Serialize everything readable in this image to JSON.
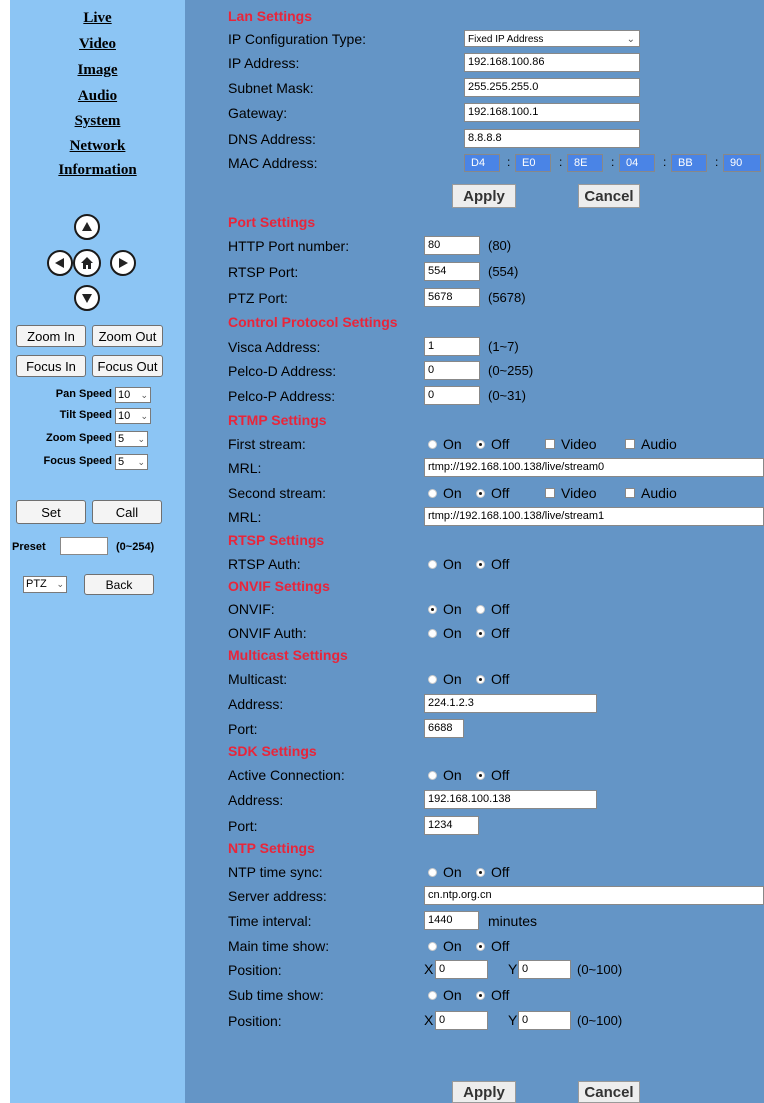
{
  "nav": {
    "items": [
      "Live",
      "Video",
      "Image",
      "Audio",
      "System",
      "Network",
      "Information"
    ]
  },
  "ptz": {
    "zoom_in": "Zoom In",
    "zoom_out": "Zoom Out",
    "focus_in": "Focus In",
    "focus_out": "Focus Out",
    "pan_speed_label": "Pan Speed",
    "pan_speed": "10",
    "tilt_speed_label": "Tilt Speed",
    "tilt_speed": "10",
    "zoom_speed_label": "Zoom Speed",
    "zoom_speed": "5",
    "focus_speed_label": "Focus Speed",
    "focus_speed": "5",
    "set": "Set",
    "call": "Call",
    "preset_label": "Preset",
    "preset_value": "",
    "preset_range": "(0~254)",
    "mode": "PTZ",
    "back": "Back"
  },
  "lan": {
    "title": "Lan Settings",
    "ip_type_label": "IP Configuration Type:",
    "ip_type": "Fixed IP Address",
    "ip_label": "IP Address:",
    "ip": "192.168.100.86",
    "mask_label": "Subnet Mask:",
    "mask": "255.255.255.0",
    "gateway_label": "Gateway:",
    "gateway": "192.168.100.1",
    "dns_label": "DNS Address:",
    "dns": "8.8.8.8",
    "mac_label": "MAC Address:",
    "mac": [
      "D4",
      "E0",
      "8E",
      "04",
      "BB",
      "90"
    ],
    "colon": ":"
  },
  "buttons": {
    "apply": "Apply",
    "cancel": "Cancel"
  },
  "port": {
    "title": "Port Settings",
    "http_label": "HTTP Port number:",
    "http": "80",
    "http_default": "(80)",
    "rtsp_label": "RTSP Port:",
    "rtsp": "554",
    "rtsp_default": "(554)",
    "ptz_label": "PTZ Port:",
    "ptz": "5678",
    "ptz_default": "(5678)"
  },
  "control": {
    "title": "Control Protocol Settings",
    "visca_label": "Visca Address:",
    "visca": "1",
    "visca_range": "(1~7)",
    "pelcod_label": "Pelco-D Address:",
    "pelcod": "0",
    "pelcod_range": "(0~255)",
    "pelcop_label": "Pelco-P Address:",
    "pelcop": "0",
    "pelcop_range": "(0~31)"
  },
  "radio": {
    "on": "On",
    "off": "Off",
    "video": "Video",
    "audio": "Audio"
  },
  "rtmp": {
    "title": "RTMP Settings",
    "first_label": "First stream:",
    "first_state": "off",
    "mrl_label": "MRL:",
    "mrl1": "rtmp://192.168.100.138/live/stream0",
    "second_label": "Second stream:",
    "second_state": "off",
    "mrl2": "rtmp://192.168.100.138/live/stream1"
  },
  "rtsp": {
    "title": "RTSP Settings",
    "auth_label": "RTSP Auth:",
    "auth_state": "off"
  },
  "onvif": {
    "title": "ONVIF Settings",
    "onvif_label": "ONVIF:",
    "onvif_state": "on",
    "auth_label": "ONVIF Auth:",
    "auth_state": "off"
  },
  "multicast": {
    "title": "Multicast Settings",
    "mc_label": "Multicast:",
    "mc_state": "off",
    "addr_label": "Address:",
    "addr": "224.1.2.3",
    "port_label": "Port:",
    "port": "6688"
  },
  "sdk": {
    "title": "SDK Settings",
    "conn_label": "Active Connection:",
    "conn_state": "off",
    "addr_label": "Address:",
    "addr": "192.168.100.138",
    "port_label": "Port:",
    "port": "1234"
  },
  "ntp": {
    "title": "NTP Settings",
    "sync_label": "NTP time sync:",
    "sync_state": "off",
    "server_label": "Server address:",
    "server": "cn.ntp.org.cn",
    "interval_label": "Time interval:",
    "interval": "1440",
    "interval_unit": "minutes",
    "main_label": "Main time show:",
    "main_state": "off",
    "pos_label": "Position:",
    "x_label": "X",
    "y_label": "Y",
    "main_x": "0",
    "main_y": "0",
    "range": "(0~100)",
    "sub_label": "Sub time show:",
    "sub_state": "off",
    "sub_x": "0",
    "sub_y": "0"
  }
}
